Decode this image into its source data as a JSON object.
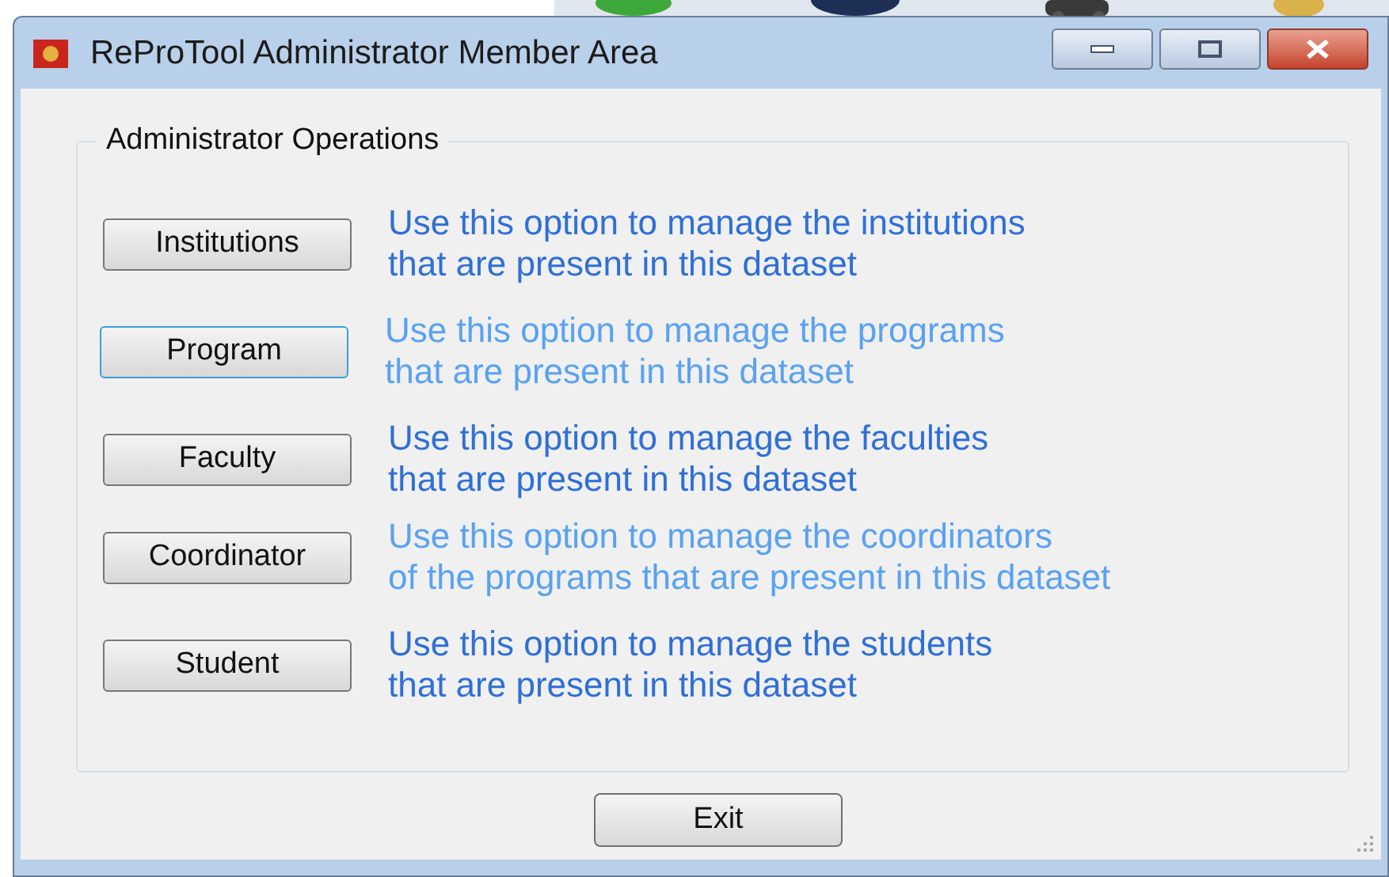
{
  "window": {
    "title": "ReProTool Administrator Member Area",
    "controls": [
      {
        "kind": "minimize"
      },
      {
        "kind": "maximize"
      },
      {
        "kind": "close"
      }
    ]
  },
  "group": {
    "title": "Administrator Operations"
  },
  "options": [
    {
      "label": "Institutions",
      "focused": false,
      "description": "Use this option to manage the institutions\nthat are present in this dataset",
      "color": "#2f6fd8"
    },
    {
      "label": "Program",
      "focused": true,
      "description": "Use this option to manage the programs\nthat are present in this dataset",
      "color": "#5aa2f2"
    },
    {
      "label": "Faculty",
      "focused": false,
      "description": "Use this option to manage the faculties\nthat are present in this dataset",
      "color": "#2f6fd8"
    },
    {
      "label": "Coordinator",
      "focused": false,
      "description": "Use this option to manage the coordinators\nof the programs that are present in this dataset",
      "color": "#5aa2f2"
    },
    {
      "label": "Student",
      "focused": false,
      "description": "Use this option to manage the students\nthat are present in this dataset",
      "color": "#2f6fd8"
    }
  ],
  "exit_button": {
    "label": "Exit"
  }
}
